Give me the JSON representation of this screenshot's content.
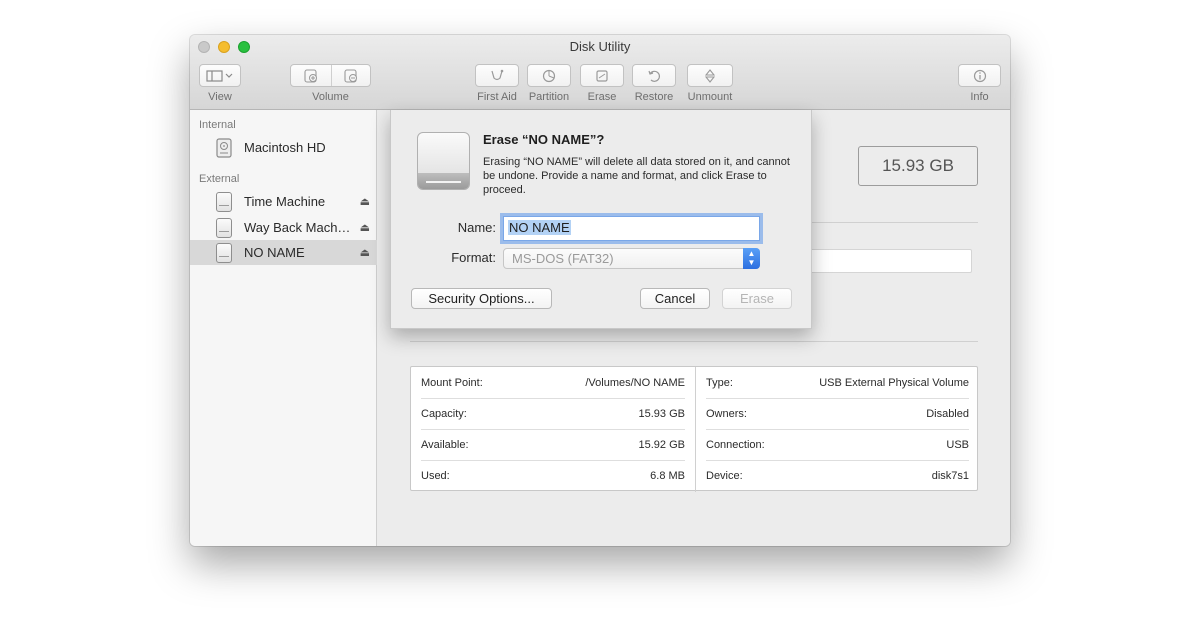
{
  "window": {
    "title": "Disk Utility"
  },
  "toolbar": {
    "view_label": "View",
    "volume_label": "Volume",
    "first_aid_label": "First Aid",
    "partition_label": "Partition",
    "erase_label": "Erase",
    "restore_label": "Restore",
    "unmount_label": "Unmount",
    "info_label": "Info"
  },
  "sidebar": {
    "internal_header": "Internal",
    "external_header": "External",
    "internal_items": [
      {
        "label": "Macintosh HD"
      }
    ],
    "external_items": [
      {
        "label": "Time Machine",
        "eject": "⏏"
      },
      {
        "label": "Way Back Mach…",
        "eject": "⏏"
      },
      {
        "label": "NO NAME",
        "eject": "⏏",
        "selected": true
      }
    ]
  },
  "main": {
    "capacity": "15.93 GB",
    "info_left": [
      {
        "key": "Mount Point:",
        "value": "/Volumes/NO NAME"
      },
      {
        "key": "Capacity:",
        "value": "15.93 GB"
      },
      {
        "key": "Available:",
        "value": "15.92 GB"
      },
      {
        "key": "Used:",
        "value": "6.8 MB"
      }
    ],
    "info_right": [
      {
        "key": "Type:",
        "value": "USB External Physical Volume"
      },
      {
        "key": "Owners:",
        "value": "Disabled"
      },
      {
        "key": "Connection:",
        "value": "USB"
      },
      {
        "key": "Device:",
        "value": "disk7s1"
      }
    ]
  },
  "sheet": {
    "title": "Erase “NO NAME”?",
    "message": "Erasing “NO NAME” will delete all data stored on it, and cannot be undone. Provide a name and format, and click Erase to proceed.",
    "name_label": "Name:",
    "name_value": "NO NAME",
    "format_label": "Format:",
    "format_value": "MS-DOS (FAT32)",
    "security_options": "Security Options...",
    "cancel": "Cancel",
    "erase": "Erase"
  },
  "colors": {
    "accent": "#2c6fe0",
    "selection": "#b3d2f5"
  }
}
